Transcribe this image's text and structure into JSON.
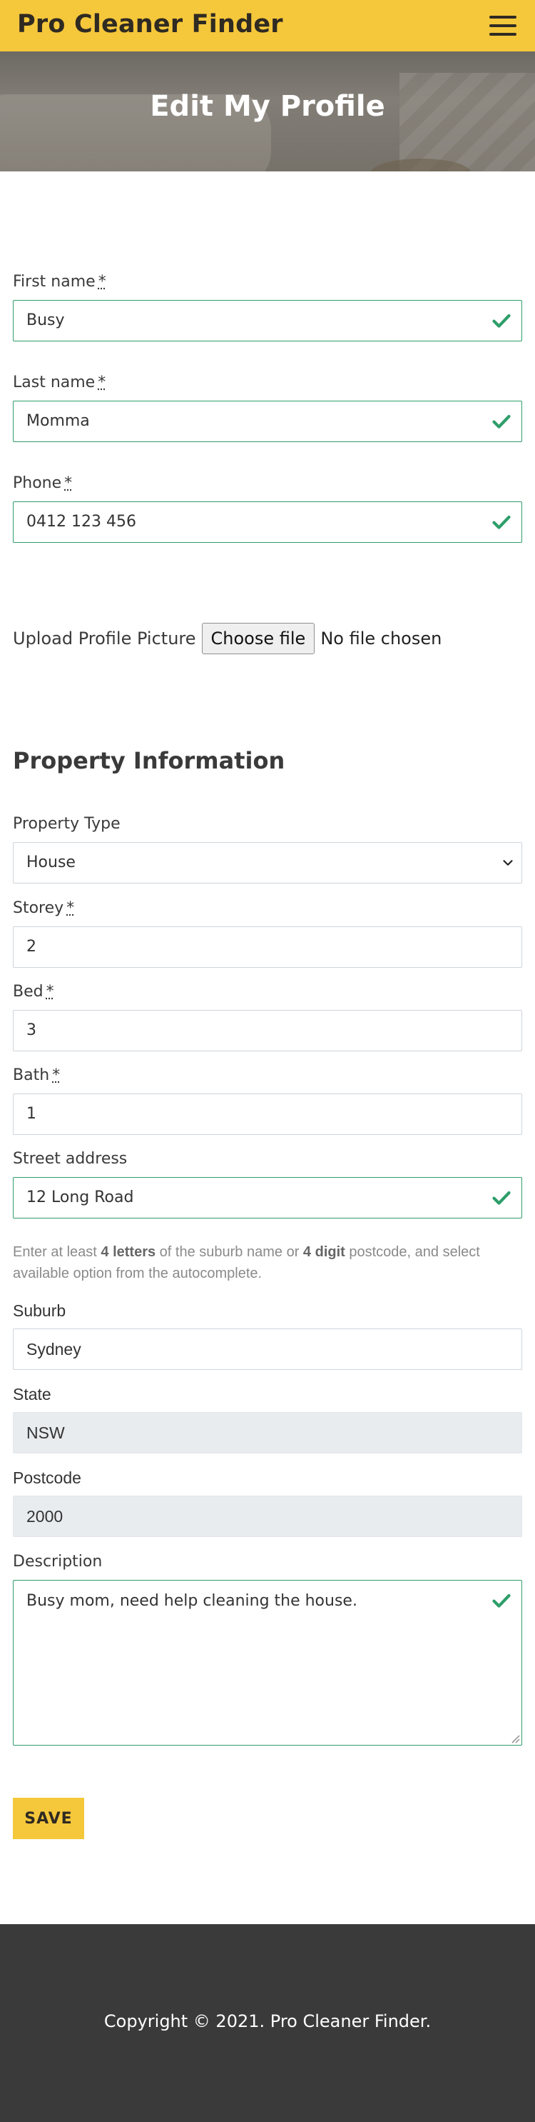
{
  "header": {
    "brand": "Pro Cleaner Finder",
    "menu_icon": "hamburger-menu-icon"
  },
  "hero": {
    "title": "Edit My Profile"
  },
  "profile": {
    "first_name": {
      "label": "First name",
      "required_mark": "*",
      "value": "Busy"
    },
    "last_name": {
      "label": "Last name",
      "required_mark": "*",
      "value": "Momma"
    },
    "phone": {
      "label": "Phone",
      "required_mark": "*",
      "value": "0412 123 456"
    },
    "upload": {
      "label": "Upload Profile Picture",
      "button": "Choose file",
      "status": "No file chosen"
    }
  },
  "property": {
    "title": "Property Information",
    "type": {
      "label": "Property Type",
      "value": "House"
    },
    "storey": {
      "label": "Storey",
      "required_mark": "*",
      "value": "2"
    },
    "bed": {
      "label": "Bed",
      "required_mark": "*",
      "value": "3"
    },
    "bath": {
      "label": "Bath",
      "required_mark": "*",
      "value": "1"
    },
    "street": {
      "label": "Street address",
      "value": "12 Long Road"
    },
    "help": {
      "part1": "Enter at least ",
      "bold1": "4 letters",
      "part2": " of the suburb name or ",
      "bold2": "4 digit",
      "part3": " postcode, and select available option from the autocomplete."
    },
    "suburb": {
      "label": "Suburb",
      "value": "Sydney"
    },
    "state": {
      "label": "State",
      "value": "NSW"
    },
    "postcode": {
      "label": "Postcode",
      "value": "2000"
    },
    "description": {
      "label": "Description",
      "value": "Busy mom, need help cleaning the house."
    }
  },
  "actions": {
    "save": "SAVE"
  },
  "footer": {
    "copyright": "Copyright © 2021. Pro Cleaner Finder."
  },
  "colors": {
    "brand_yellow": "#f5c73b",
    "valid_green": "#2e9e6a",
    "footer_bg": "#3a3a3a"
  }
}
